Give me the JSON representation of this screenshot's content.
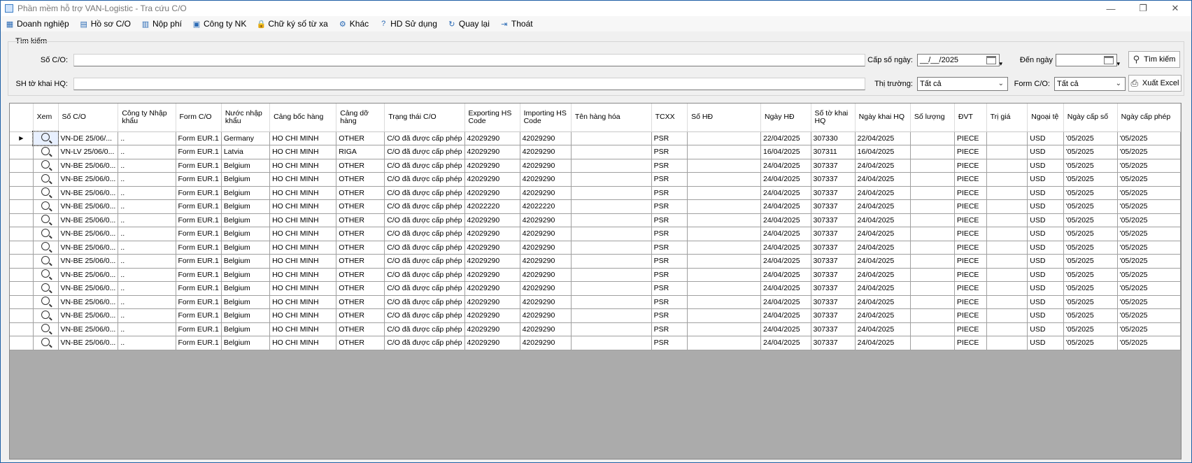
{
  "window": {
    "title": "Phần mềm hỗ trợ VAN-Logistic - Tra cứu C/O"
  },
  "menu": [
    {
      "label": "Doanh nghiệp",
      "icon": "building-icon"
    },
    {
      "label": "Hồ sơ C/O",
      "icon": "document-icon"
    },
    {
      "label": "Nộp phí",
      "icon": "invoice-icon"
    },
    {
      "label": "Công ty NK",
      "icon": "company-icon"
    },
    {
      "label": "Chữ ký số từ xa",
      "icon": "lock-icon"
    },
    {
      "label": "Khác",
      "icon": "gear-icon"
    },
    {
      "label": "HD Sử dụng",
      "icon": "help-icon"
    },
    {
      "label": "Quay lại",
      "icon": "refresh-icon"
    },
    {
      "label": "Thoát",
      "icon": "exit-icon"
    }
  ],
  "search": {
    "legend": "Tìm kiếm",
    "so_co_label": "Số C/O:",
    "shtk_label": "SH tờ khai HQ:",
    "cap_so_ngay_label": "Cấp số ngày:",
    "cap_so_ngay_value": "__/__/2025",
    "den_ngay_label": "Đến ngày",
    "thi_truong_label": "Thị trường:",
    "thi_truong_value": "Tất cả",
    "form_co_label": "Form C/O:",
    "form_co_value": "Tất cả",
    "search_button": "Tìm kiếm",
    "export_button": "Xuất Excel"
  },
  "table": {
    "headers": [
      "Xem",
      "Số C/O",
      "Công ty Nhập khẩu",
      "Form C/O",
      "Nước nhập khẩu",
      "Cảng bốc hàng",
      "Cảng dỡ hàng",
      "Trạng thái C/O",
      "Exporting HS Code",
      "Importing HS Code",
      "Tên hàng hóa",
      "TCXX",
      "Số HĐ",
      "Ngày HĐ",
      "Số tờ khai HQ",
      "Ngày khai HQ",
      "Số lượng",
      "ĐVT",
      "Trị giá",
      "Ngoại tệ",
      "Ngày cấp số",
      "Ngày cấp phép"
    ],
    "rows": [
      [
        "VN-DE 25/06/...",
        "..",
        "Form EUR.1",
        "Germany",
        "HO CHI MINH",
        "OTHER",
        "C/O đã được cấp phép",
        "42029290",
        "42029290",
        "",
        "PSR",
        "",
        "22/04/2025",
        "307330",
        "22/04/2025",
        "",
        "PIECE",
        "",
        "USD",
        "'05/2025",
        "'05/2025"
      ],
      [
        "VN-LV 25/06/0...",
        "..",
        "Form EUR.1",
        "Latvia",
        "HO CHI MINH",
        "RIGA",
        "C/O đã được cấp phép",
        "42029290",
        "42029290",
        "",
        "PSR",
        "",
        "16/04/2025",
        "307311",
        "16/04/2025",
        "",
        "PIECE",
        "",
        "USD",
        "'05/2025",
        "'05/2025"
      ],
      [
        "VN-BE 25/06/0...",
        "..",
        "Form EUR.1",
        "Belgium",
        "HO CHI MINH",
        "OTHER",
        "C/O đã được cấp phép",
        "42029290",
        "42029290",
        "",
        "PSR",
        "",
        "24/04/2025",
        "307337",
        "24/04/2025",
        "",
        "PIECE",
        "",
        "USD",
        "'05/2025",
        "'05/2025"
      ],
      [
        "VN-BE 25/06/0...",
        "..",
        "Form EUR.1",
        "Belgium",
        "HO CHI MINH",
        "OTHER",
        "C/O đã được cấp phép",
        "42029290",
        "42029290",
        "",
        "PSR",
        "",
        "24/04/2025",
        "307337",
        "24/04/2025",
        "",
        "PIECE",
        "",
        "USD",
        "'05/2025",
        "'05/2025"
      ],
      [
        "VN-BE 25/06/0...",
        "..",
        "Form EUR.1",
        "Belgium",
        "HO CHI MINH",
        "OTHER",
        "C/O đã được cấp phép",
        "42029290",
        "42029290",
        "",
        "PSR",
        "",
        "24/04/2025",
        "307337",
        "24/04/2025",
        "",
        "PIECE",
        "",
        "USD",
        "'05/2025",
        "'05/2025"
      ],
      [
        "VN-BE 25/06/0...",
        "..",
        "Form EUR.1",
        "Belgium",
        "HO CHI MINH",
        "OTHER",
        "C/O đã được cấp phép",
        "42022220",
        "42022220",
        "",
        "PSR",
        "",
        "24/04/2025",
        "307337",
        "24/04/2025",
        "",
        "PIECE",
        "",
        "USD",
        "'05/2025",
        "'05/2025"
      ],
      [
        "VN-BE 25/06/0...",
        "..",
        "Form EUR.1",
        "Belgium",
        "HO CHI MINH",
        "OTHER",
        "C/O đã được cấp phép",
        "42029290",
        "42029290",
        "",
        "PSR",
        "",
        "24/04/2025",
        "307337",
        "24/04/2025",
        "",
        "PIECE",
        "",
        "USD",
        "'05/2025",
        "'05/2025"
      ],
      [
        "VN-BE 25/06/0...",
        "..",
        "Form EUR.1",
        "Belgium",
        "HO CHI MINH",
        "OTHER",
        "C/O đã được cấp phép",
        "42029290",
        "42029290",
        "",
        "PSR",
        "",
        "24/04/2025",
        "307337",
        "24/04/2025",
        "",
        "PIECE",
        "",
        "USD",
        "'05/2025",
        "'05/2025"
      ],
      [
        "VN-BE 25/06/0...",
        "..",
        "Form EUR.1",
        "Belgium",
        "HO CHI MINH",
        "OTHER",
        "C/O đã được cấp phép",
        "42029290",
        "42029290",
        "",
        "PSR",
        "",
        "24/04/2025",
        "307337",
        "24/04/2025",
        "",
        "PIECE",
        "",
        "USD",
        "'05/2025",
        "'05/2025"
      ],
      [
        "VN-BE 25/06/0...",
        "..",
        "Form EUR.1",
        "Belgium",
        "HO CHI MINH",
        "OTHER",
        "C/O đã được cấp phép",
        "42029290",
        "42029290",
        "",
        "PSR",
        "",
        "24/04/2025",
        "307337",
        "24/04/2025",
        "",
        "PIECE",
        "",
        "USD",
        "'05/2025",
        "'05/2025"
      ],
      [
        "VN-BE 25/06/0...",
        "..",
        "Form EUR.1",
        "Belgium",
        "HO CHI MINH",
        "OTHER",
        "C/O đã được cấp phép",
        "42029290",
        "42029290",
        "",
        "PSR",
        "",
        "24/04/2025",
        "307337",
        "24/04/2025",
        "",
        "PIECE",
        "",
        "USD",
        "'05/2025",
        "'05/2025"
      ],
      [
        "VN-BE 25/06/0...",
        "..",
        "Form EUR.1",
        "Belgium",
        "HO CHI MINH",
        "OTHER",
        "C/O đã được cấp phép",
        "42029290",
        "42029290",
        "",
        "PSR",
        "",
        "24/04/2025",
        "307337",
        "24/04/2025",
        "",
        "PIECE",
        "",
        "USD",
        "'05/2025",
        "'05/2025"
      ],
      [
        "VN-BE 25/06/0...",
        "..",
        "Form EUR.1",
        "Belgium",
        "HO CHI MINH",
        "OTHER",
        "C/O đã được cấp phép",
        "42029290",
        "42029290",
        "",
        "PSR",
        "",
        "24/04/2025",
        "307337",
        "24/04/2025",
        "",
        "PIECE",
        "",
        "USD",
        "'05/2025",
        "'05/2025"
      ],
      [
        "VN-BE 25/06/0...",
        "..",
        "Form EUR.1",
        "Belgium",
        "HO CHI MINH",
        "OTHER",
        "C/O đã được cấp phép",
        "42029290",
        "42029290",
        "",
        "PSR",
        "",
        "24/04/2025",
        "307337",
        "24/04/2025",
        "",
        "PIECE",
        "",
        "USD",
        "'05/2025",
        "'05/2025"
      ],
      [
        "VN-BE 25/06/0...",
        "..",
        "Form EUR.1",
        "Belgium",
        "HO CHI MINH",
        "OTHER",
        "C/O đã được cấp phép",
        "42029290",
        "42029290",
        "",
        "PSR",
        "",
        "24/04/2025",
        "307337",
        "24/04/2025",
        "",
        "PIECE",
        "",
        "USD",
        "'05/2025",
        "'05/2025"
      ],
      [
        "VN-BE 25/06/0...",
        "..",
        "Form EUR.1",
        "Belgium",
        "HO CHI MINH",
        "OTHER",
        "C/O đã được cấp phép",
        "42029290",
        "42029290",
        "",
        "PSR",
        "",
        "24/04/2025",
        "307337",
        "24/04/2025",
        "",
        "PIECE",
        "",
        "USD",
        "'05/2025",
        "'05/2025"
      ]
    ]
  }
}
